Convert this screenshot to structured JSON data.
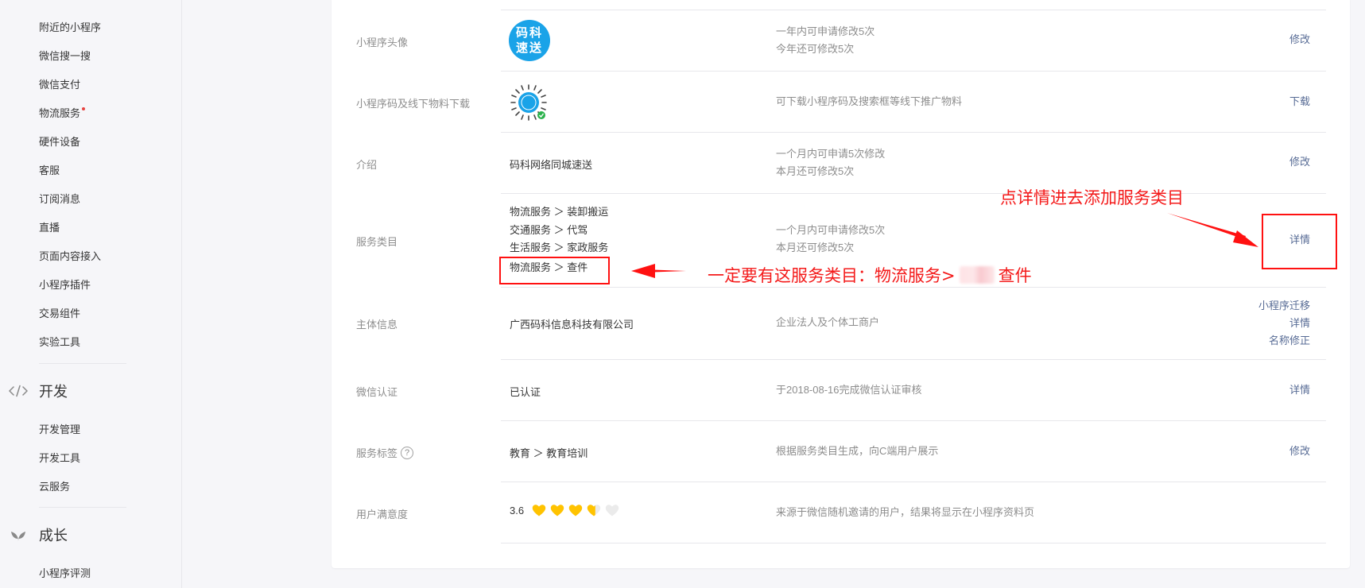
{
  "sidebar": {
    "items_top": [
      "附近的小程序",
      "微信搜一搜",
      "微信支付",
      "物流服务",
      "硬件设备",
      "客服",
      "订阅消息",
      "直播",
      "页面内容接入",
      "小程序插件",
      "交易组件",
      "实验工具"
    ],
    "dev_section": {
      "title": "开发",
      "icon": "code-icon",
      "items": [
        "开发管理",
        "开发工具",
        "云服务"
      ]
    },
    "growth_section": {
      "title": "成长",
      "icon": "leaf-icon",
      "items": [
        "小程序评测"
      ]
    }
  },
  "rows": {
    "avatar": {
      "label": "小程序头像",
      "logo_text": "码科速送",
      "desc": [
        "一年内可申请修改5次",
        "今年还可修改5次"
      ],
      "action": "修改"
    },
    "qrcode": {
      "label": "小程序码及线下物料下载",
      "desc": "可下载小程序码及搜索框等线下推广物料",
      "action": "下载"
    },
    "intro": {
      "label": "介绍",
      "value": "码科网络同城速送",
      "desc": [
        "一个月内可申请5次修改",
        "本月还可修改5次"
      ],
      "action": "修改"
    },
    "category": {
      "label": "服务类目",
      "items": [
        "物流服务 ＞ 装卸搬运",
        "交通服务 ＞ 代驾",
        "生活服务 ＞ 家政服务",
        "物流服务 ＞ 查件"
      ],
      "desc": [
        "一个月内可申请修改5次",
        "本月还可修改5次"
      ],
      "action": "详情"
    },
    "entity": {
      "label": "主体信息",
      "value": "广西码科信息科技有限公司",
      "desc": "企业法人及个体工商户",
      "actions": [
        "小程序迁移",
        "详情",
        "名称修正"
      ]
    },
    "wechat_auth": {
      "label": "微信认证",
      "value": "已认证",
      "desc": "于2018-08-16完成微信认证审核",
      "action": "详情"
    },
    "service_tag": {
      "label": "服务标签",
      "help": "?",
      "value": "教育 ＞ 教育培训",
      "desc": "根据服务类目生成，向C端用户展示",
      "action": "修改"
    },
    "satisfaction": {
      "label": "用户满意度",
      "score": "3.6",
      "rating": 3.6,
      "rating_max": 5,
      "desc": "来源于微信随机邀请的用户，结果将显示在小程序资料页"
    }
  },
  "annotations": {
    "top": "点详情进去添加服务类目",
    "required_prefix": "一定要有这服务类目：物流服务>",
    "required_suffix": "查件"
  },
  "colors": {
    "link": "#576b95",
    "annotation": "#f41a1a",
    "heart": "#ffc300",
    "logo_bg": "#1aa3e8"
  }
}
